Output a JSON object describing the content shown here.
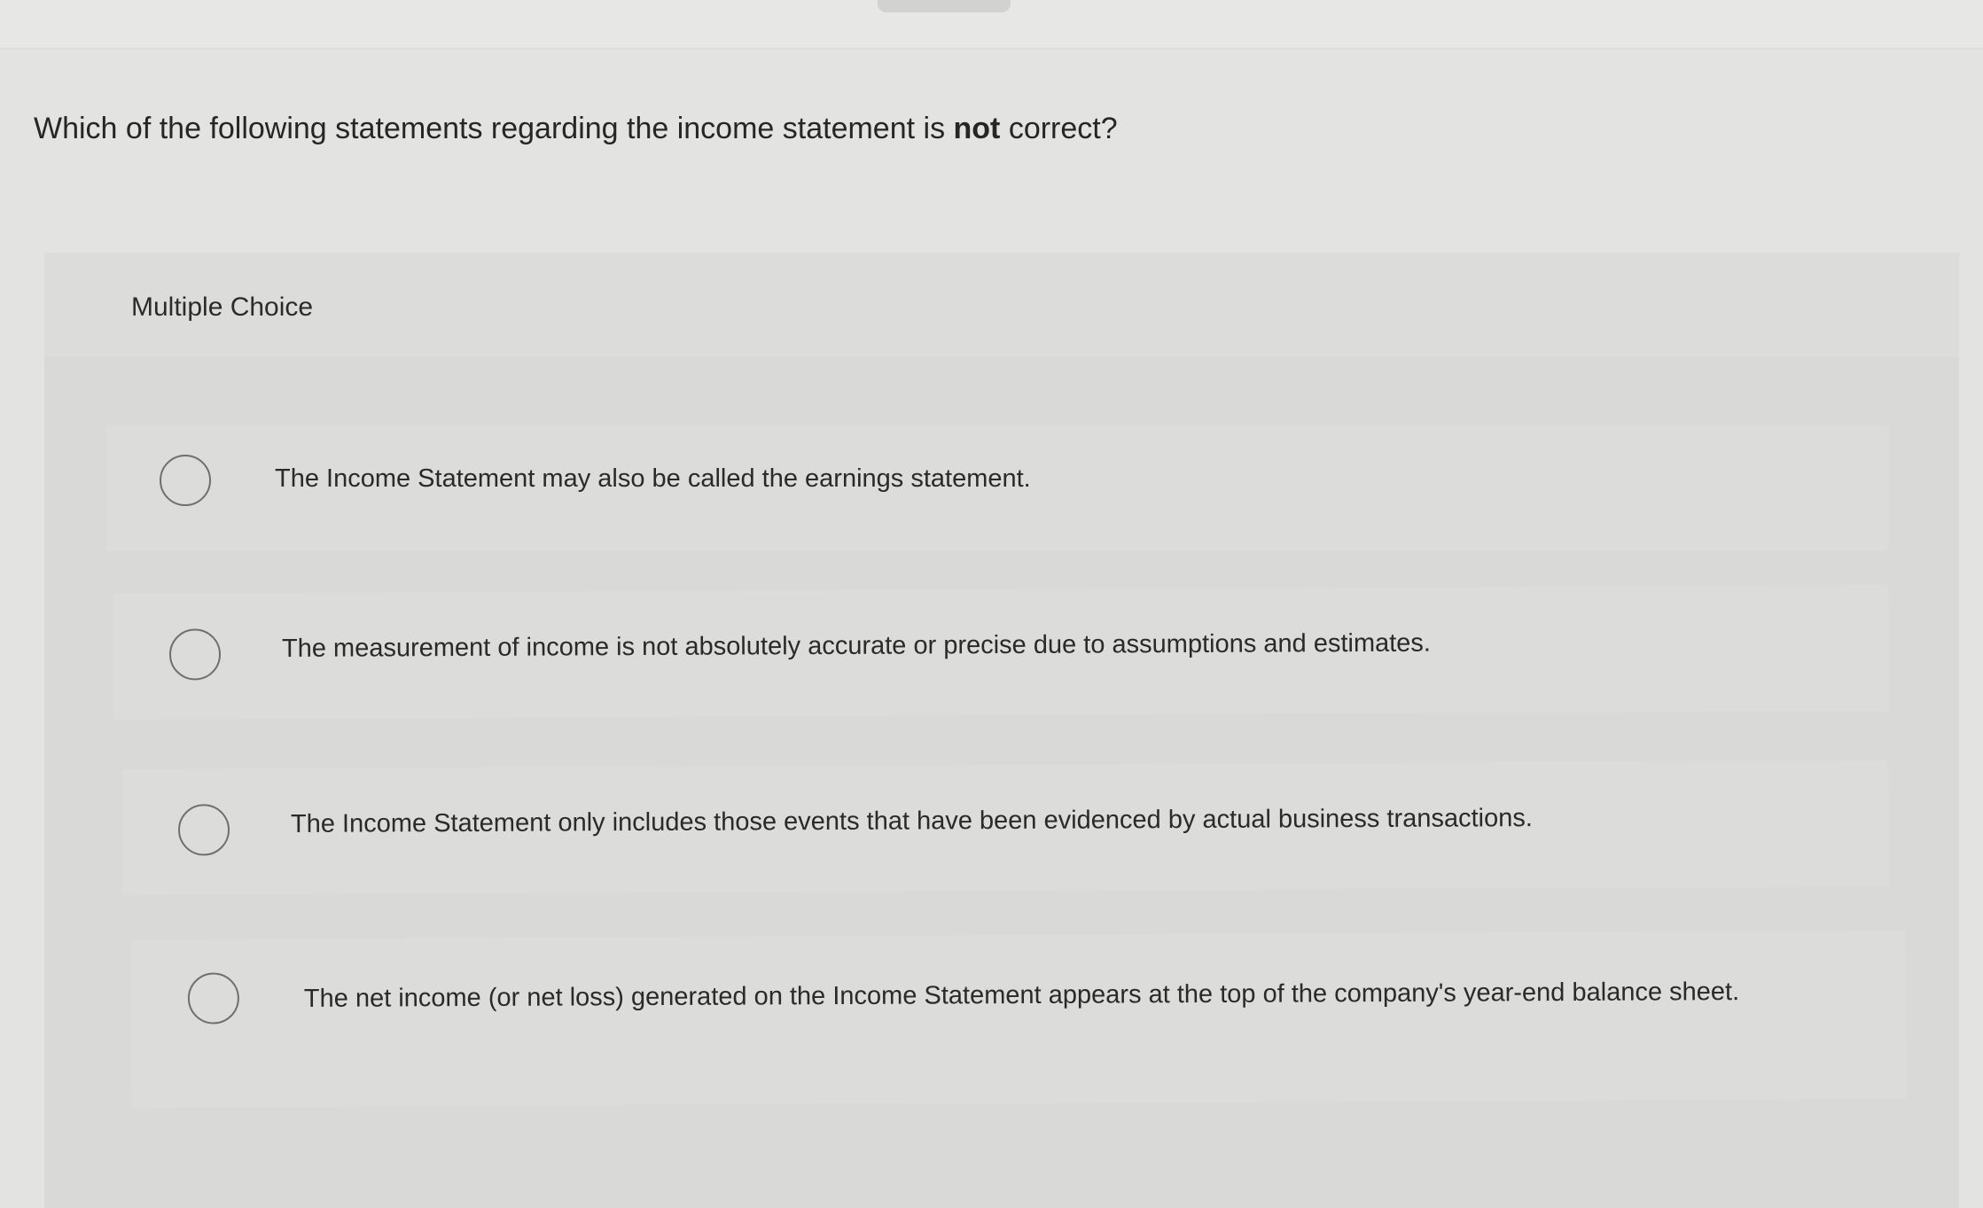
{
  "question": {
    "text_before": "Which of the following statements regarding the income statement is ",
    "emphasis": "not",
    "text_after": " correct?"
  },
  "multiple_choice": {
    "label": "Multiple Choice",
    "options": [
      {
        "text": "The Income Statement may also be called the earnings statement."
      },
      {
        "text": "The measurement of income is not absolutely accurate or precise due to assumptions and estimates."
      },
      {
        "text": "The Income Statement only includes those events that have been evidenced by actual business transactions."
      },
      {
        "text": "The net income (or net loss) generated on the Income Statement appears at the top of the company's year-end balance sheet."
      }
    ]
  },
  "colors": {
    "page_background": "#e3e3e1",
    "panel_background": "#d9d9d7",
    "radio_border": "#6f6f6f",
    "text": "#2a2a2a"
  }
}
